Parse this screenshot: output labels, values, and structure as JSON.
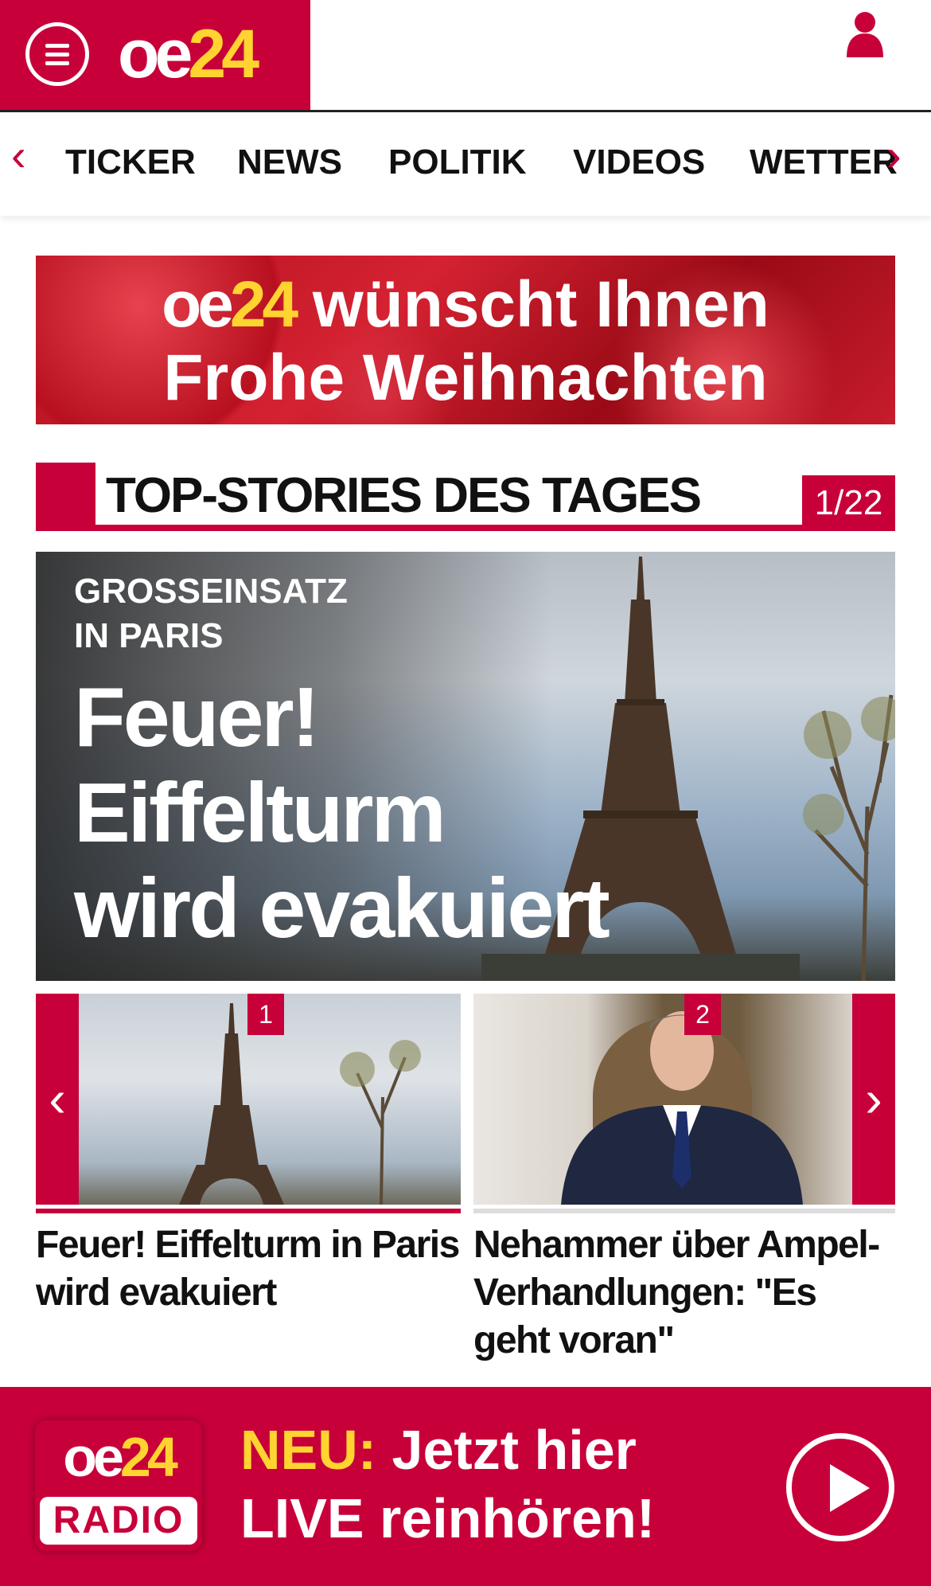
{
  "header": {
    "logo_oe": "oe",
    "logo_24": "24",
    "brand_color": "#c8003a",
    "accent_color": "#ffd430"
  },
  "nav": {
    "items": [
      "TICKER",
      "NEWS",
      "POLITIK",
      "VIDEOS",
      "WETTER"
    ],
    "left_arrow": "‹",
    "right_arrow": "›"
  },
  "banner": {
    "logo_oe": "oe",
    "logo_24": "24",
    "line1": "wünscht Ihnen",
    "line2": "Frohe Weihnachten"
  },
  "top_stories": {
    "title": "TOP-STORIES DES TAGES",
    "counter": "1/22"
  },
  "hero": {
    "kicker_line1": "GROSSEINSATZ",
    "kicker_line2": "IN PARIS",
    "headline_line1": "Feuer!",
    "headline_line2": "Eiffelturm",
    "headline_line3": "wird evakuiert"
  },
  "thumbnails": [
    {
      "badge": "1",
      "caption": "Feuer! Eiffelturm in Paris wird evakuiert"
    },
    {
      "badge": "2",
      "caption": "Nehammer über Ampel-Verhandlungen: \"Es geht voran\""
    }
  ],
  "carousel": {
    "left_arrow": "‹",
    "right_arrow": "›"
  },
  "radio": {
    "logo_oe": "oe",
    "logo_24": "24",
    "logo_radio": "RADIO",
    "neu": "NEU:",
    "text1_rest": " Jetzt hier",
    "text2": "LIVE reinhören!"
  }
}
